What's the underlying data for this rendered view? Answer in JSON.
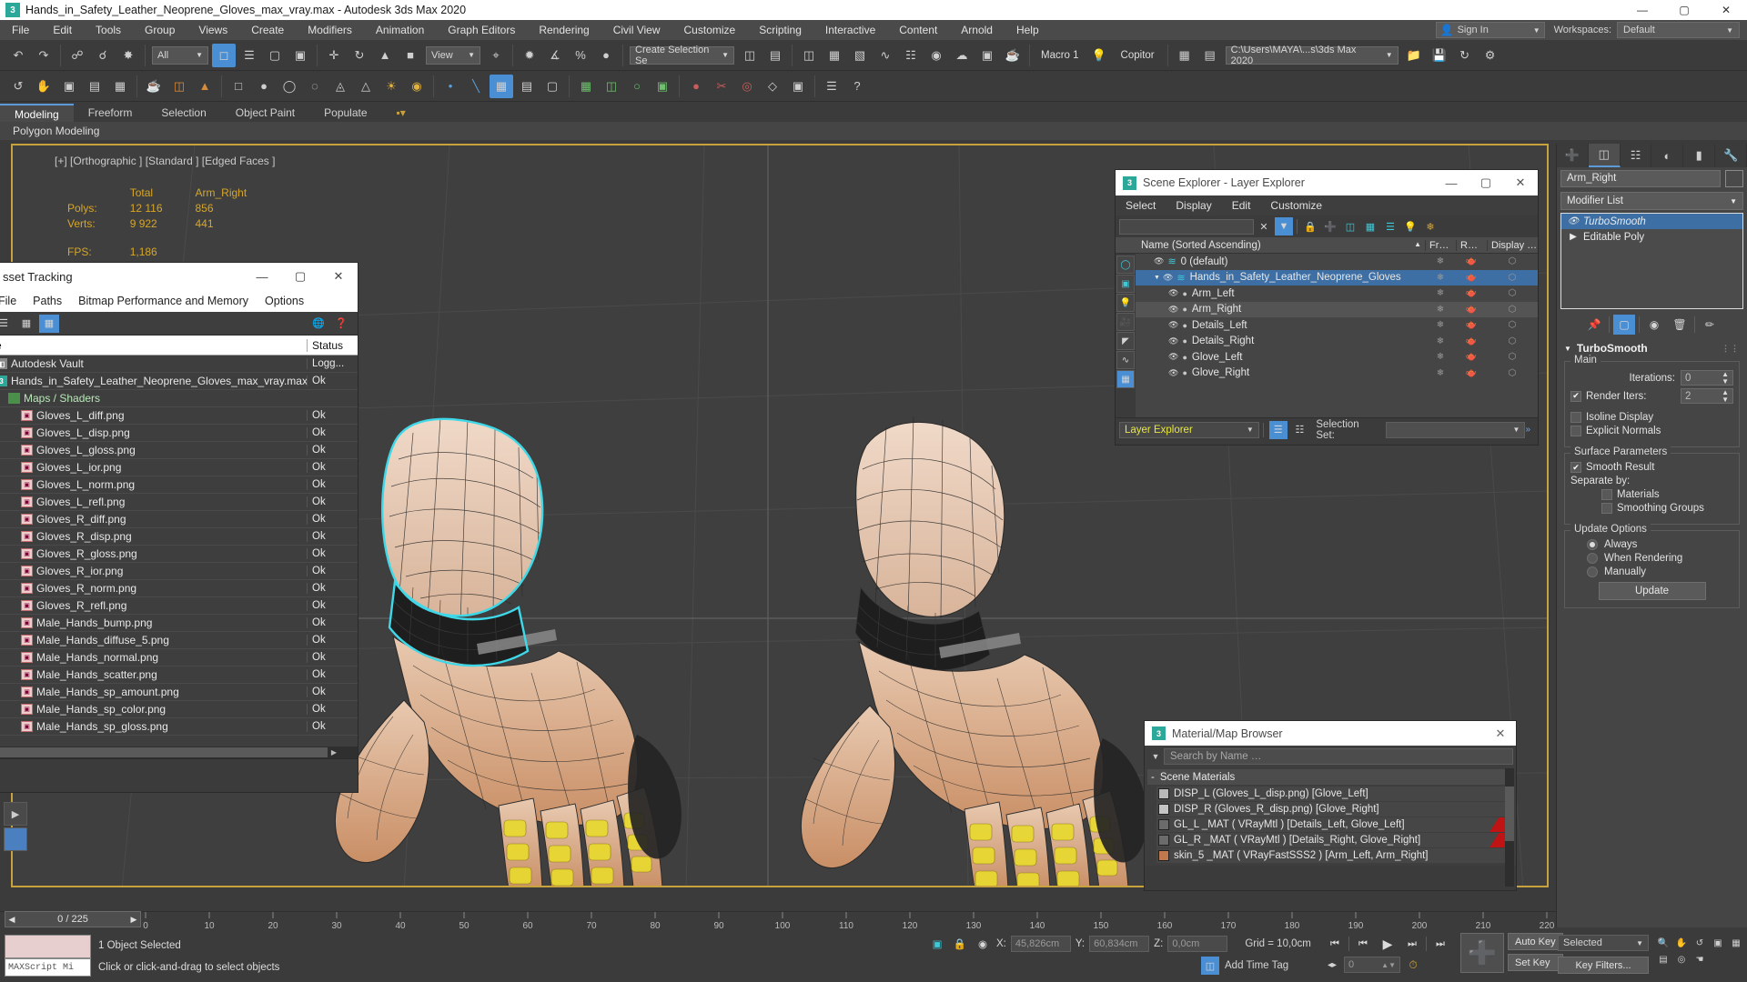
{
  "titlebar": {
    "icon": "3dsmax-icon",
    "text": "Hands_in_Safety_Leather_Neoprene_Gloves_max_vray.max - Autodesk 3ds Max 2020",
    "minimize": "—",
    "maximize": "▢",
    "close": "✕"
  },
  "menubar": {
    "items": [
      "File",
      "Edit",
      "Tools",
      "Group",
      "Views",
      "Create",
      "Modifiers",
      "Animation",
      "Graph Editors",
      "Rendering",
      "Civil View",
      "Customize",
      "Scripting",
      "Interactive",
      "Content",
      "Arnold",
      "Help"
    ],
    "signin_label": "Sign In",
    "workspaces_label": "Workspaces:",
    "workspaces_value": "Default"
  },
  "toolbar1": {
    "selection_filter": "All",
    "view_mode": "View",
    "selection_set": "Create Selection Se",
    "macro": "Macro 1",
    "copitor": "Copitor",
    "path": "C:\\Users\\MAYA\\...s\\3ds Max 2020"
  },
  "ribbon": {
    "tabs": [
      "Modeling",
      "Freeform",
      "Selection",
      "Object Paint",
      "Populate"
    ],
    "active_tab": "Modeling",
    "subtitle": "Polygon Modeling"
  },
  "viewport": {
    "label": "[+] [Orthographic ] [Standard ] [Edged Faces ]",
    "stats": {
      "col_total": "Total",
      "col_object": "Arm_Right",
      "polys_label": "Polys:",
      "polys_total": "12 116",
      "polys_object": "856",
      "verts_label": "Verts:",
      "verts_total": "9 922",
      "verts_object": "441",
      "fps_label": "FPS:",
      "fps_value": "1,186"
    }
  },
  "asset_tracking": {
    "title": "sset Tracking",
    "menu": [
      "File",
      "Paths",
      "Bitmap Performance and Memory",
      "Options"
    ],
    "col_name": "e",
    "col_status": "Status",
    "rows": [
      {
        "name": "Autodesk Vault",
        "status": "Logg...",
        "icon": "vault-icon",
        "indent": 0
      },
      {
        "name": "Hands_in_Safety_Leather_Neoprene_Gloves_max_vray.max",
        "status": "Ok",
        "icon": "max-icon",
        "indent": 0
      },
      {
        "name": "Maps / Shaders",
        "status": "",
        "icon": "folder-icon",
        "indent": 1
      },
      {
        "name": "Gloves_L_diff.png",
        "status": "Ok",
        "icon": "map-icon",
        "indent": 2
      },
      {
        "name": "Gloves_L_disp.png",
        "status": "Ok",
        "icon": "map-icon",
        "indent": 2
      },
      {
        "name": "Gloves_L_gloss.png",
        "status": "Ok",
        "icon": "map-icon",
        "indent": 2
      },
      {
        "name": "Gloves_L_ior.png",
        "status": "Ok",
        "icon": "map-icon",
        "indent": 2
      },
      {
        "name": "Gloves_L_norm.png",
        "status": "Ok",
        "icon": "map-icon",
        "indent": 2
      },
      {
        "name": "Gloves_L_refl.png",
        "status": "Ok",
        "icon": "map-icon",
        "indent": 2
      },
      {
        "name": "Gloves_R_diff.png",
        "status": "Ok",
        "icon": "map-icon",
        "indent": 2
      },
      {
        "name": "Gloves_R_disp.png",
        "status": "Ok",
        "icon": "map-icon",
        "indent": 2
      },
      {
        "name": "Gloves_R_gloss.png",
        "status": "Ok",
        "icon": "map-icon",
        "indent": 2
      },
      {
        "name": "Gloves_R_ior.png",
        "status": "Ok",
        "icon": "map-icon",
        "indent": 2
      },
      {
        "name": "Gloves_R_norm.png",
        "status": "Ok",
        "icon": "map-icon",
        "indent": 2
      },
      {
        "name": "Gloves_R_refl.png",
        "status": "Ok",
        "icon": "map-icon",
        "indent": 2
      },
      {
        "name": "Male_Hands_bump.png",
        "status": "Ok",
        "icon": "map-icon",
        "indent": 2
      },
      {
        "name": "Male_Hands_diffuse_5.png",
        "status": "Ok",
        "icon": "map-icon",
        "indent": 2
      },
      {
        "name": "Male_Hands_normal.png",
        "status": "Ok",
        "icon": "map-icon",
        "indent": 2
      },
      {
        "name": "Male_Hands_scatter.png",
        "status": "Ok",
        "icon": "map-icon",
        "indent": 2
      },
      {
        "name": "Male_Hands_sp_amount.png",
        "status": "Ok",
        "icon": "map-icon",
        "indent": 2
      },
      {
        "name": "Male_Hands_sp_color.png",
        "status": "Ok",
        "icon": "map-icon",
        "indent": 2
      },
      {
        "name": "Male_Hands_sp_gloss.png",
        "status": "Ok",
        "icon": "map-icon",
        "indent": 2
      }
    ]
  },
  "scene_explorer": {
    "title": "Scene Explorer - Layer Explorer",
    "menu": [
      "Select",
      "Display",
      "Edit",
      "Customize"
    ],
    "search_value": "",
    "col_name": "Name (Sorted Ascending)",
    "col_sort_arrow": "▲",
    "col_frozen": "Fr…",
    "col_render": "R…",
    "col_display": "Display …",
    "rows": [
      {
        "name": "0 (default)",
        "indent": 1,
        "type": "layer",
        "state": "normal"
      },
      {
        "name": "Hands_in_Safety_Leather_Neoprene_Gloves",
        "indent": 1,
        "type": "layer",
        "state": "selected",
        "expanded": true
      },
      {
        "name": "Arm_Left",
        "indent": 2,
        "type": "object",
        "state": "normal"
      },
      {
        "name": "Arm_Right",
        "indent": 2,
        "type": "object",
        "state": "hover"
      },
      {
        "name": "Details_Left",
        "indent": 2,
        "type": "object",
        "state": "normal"
      },
      {
        "name": "Details_Right",
        "indent": 2,
        "type": "object",
        "state": "normal"
      },
      {
        "name": "Glove_Left",
        "indent": 2,
        "type": "object",
        "state": "normal"
      },
      {
        "name": "Glove_Right",
        "indent": 2,
        "type": "object",
        "state": "normal"
      }
    ],
    "footer_combo": "Layer Explorer",
    "selection_set_label": "Selection Set:",
    "selection_set_value": "",
    "overflow": "»"
  },
  "material_browser": {
    "title": "Material/Map Browser",
    "search_placeholder": "Search by Name …",
    "group_label": "Scene Materials",
    "group_toggle": "-",
    "items": [
      {
        "name": "DISP_L (Gloves_L_disp.png) [Glove_Left]",
        "swatch": "#b8b8b8",
        "tag": false
      },
      {
        "name": "DISP_R (Gloves_R_disp.png) [Glove_Right]",
        "swatch": "#c4c4c4",
        "tag": false
      },
      {
        "name": "GL_L _MAT ( VRayMtl ) [Details_Left, Glove_Left]",
        "swatch": "#6b6b6b",
        "tag": true
      },
      {
        "name": "GL_R _MAT ( VRayMtl ) [Details_Right, Glove_Right]",
        "swatch": "#6b6b6b",
        "tag": true
      },
      {
        "name": "skin_5 _MAT ( VRayFastSSS2 ) [Arm_Left, Arm_Right]",
        "swatch": "#c0794e",
        "tag": false
      }
    ]
  },
  "command_panel": {
    "tabs": [
      "+",
      "modify-icon",
      "hierarchy-icon",
      "motion-icon",
      "display-icon",
      "utilities-icon"
    ],
    "object_name": "Arm_Right",
    "modifier_list_label": "Modifier List",
    "stack": [
      {
        "name": "TurboSmooth",
        "selected": true
      },
      {
        "name": "Editable Poly",
        "selected": false
      }
    ],
    "rollout_title": "TurboSmooth",
    "main_group": "Main",
    "iterations_label": "Iterations:",
    "iterations_value": "0",
    "render_iters_label": "Render Iters:",
    "render_iters_value": "2",
    "render_iters_checked": true,
    "isoline_label": "Isoline Display",
    "isoline_checked": false,
    "explicit_label": "Explicit Normals",
    "explicit_checked": false,
    "surface_group": "Surface Parameters",
    "smooth_result_label": "Smooth Result",
    "smooth_result_checked": true,
    "separate_by_label": "Separate by:",
    "materials_label": "Materials",
    "materials_checked": false,
    "smoothing_groups_label": "Smoothing Groups",
    "smoothing_groups_checked": false,
    "update_group": "Update Options",
    "update_options": [
      "Always",
      "When Rendering",
      "Manually"
    ],
    "update_selected": "Always",
    "update_button": "Update"
  },
  "timeline": {
    "current_frame": "0 / 225",
    "ticks": [
      "0",
      "10",
      "20",
      "30",
      "40",
      "50",
      "60",
      "70",
      "80",
      "90",
      "100",
      "110",
      "120",
      "130",
      "140",
      "150",
      "160",
      "170",
      "180",
      "190",
      "200",
      "210",
      "220"
    ]
  },
  "statusbar": {
    "maxscript_label": "MAXScript Mi",
    "selection_text": "1 Object Selected",
    "prompt_text": "Click or click-and-drag to select objects",
    "x_label": "X:",
    "x_value": "45,826cm",
    "y_label": "Y:",
    "y_value": "60,834cm",
    "z_label": "Z:",
    "z_value": "0,0cm",
    "grid_text": "Grid = 10,0cm",
    "add_time_tag": "Add Time Tag",
    "auto_key": "Auto Key",
    "set_key": "Set Key",
    "key_filters": "Key Filters...",
    "selected_label": "Selected",
    "frame_field": "0"
  },
  "colors": {
    "accent_blue": "#4a8fd4",
    "viewport_border": "#c8a23c",
    "stats_yellow": "#d6a62a",
    "selection_cyan": "#3fd8e8",
    "panel_bg": "#3b3b3b"
  }
}
